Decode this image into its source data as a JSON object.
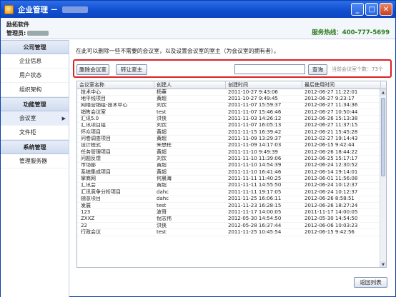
{
  "window": {
    "title": "企业管理 －",
    "min": "_",
    "max": "□",
    "close": "✕"
  },
  "header": {
    "company": "励拓软件",
    "admin_label": "管理员:",
    "hotline": "服务热线：400-777-5699"
  },
  "sidebar": {
    "sections": [
      {
        "title": "公司管理",
        "items": [
          "企业信息",
          "用户状态",
          "组织架构"
        ]
      },
      {
        "title": "功能管理",
        "items": [
          "会议室",
          "文件柜"
        ]
      },
      {
        "title": "系统管理",
        "items": [
          "管理服务器"
        ]
      }
    ],
    "active_item": "会议室"
  },
  "main": {
    "description": "在此可以删除一些不需要的会议室，以及设置会议室的室主（为会议室的拥有者）。",
    "buttons": {
      "delete": "删除会议室",
      "transfer": "转让室主",
      "search": "查询",
      "back": "返回列表"
    },
    "search_value": "",
    "count_label": "当前会议室个数：73个"
  },
  "table": {
    "columns": [
      "会议室名称",
      "创建人",
      "创建时间",
      "最后使用时间"
    ],
    "rows": [
      [
        "技术中心",
        "杨華",
        "2011-10-27 9:43:06",
        "2012-06-27 11:22:01"
      ],
      [
        "地平线项目",
        "黄超",
        "2011-10-27 9:49:45",
        "2012-06-27 9:23:17"
      ],
      [
        "网络营销组-技术中心",
        "刘饮",
        "2011-11-07 15:59:37",
        "2012-06-27 11:34:36"
      ],
      [
        "销售会议室",
        "test",
        "2011-11-07 15:46:46",
        "2012-06-27 10:50:44"
      ],
      [
        "汇讯5.0",
        "洪侠",
        "2011-11-03 14:26:12",
        "2012-06-26 15:13:38"
      ],
      [
        "汇讯项目组",
        "刘饮",
        "2011-11-07 16:05:13",
        "2012-06-27 11:37:15"
      ],
      [
        "怀众项目",
        "黄超",
        "2011-11-15 16:39:42",
        "2012-06-21 15:45:28"
      ],
      [
        "问卷调查项目",
        "黄超",
        "2011-11-09 13:29:37",
        "2012-02-27 19:14:43"
      ],
      [
        "设计模式",
        "朱懋柱",
        "2011-11-09 14:17:03",
        "2012-06-15 9:42:44"
      ],
      [
        "任务管理项目",
        "黄超",
        "2011-11-10 9:49:39",
        "2012-06-26 18:44:22"
      ],
      [
        "问题反馈",
        "刘饮",
        "2011-11-10 11:39:06",
        "2012-06-25 15:17:17"
      ],
      [
        "市场部",
        "黄超",
        "2011-11-10 14:54:39",
        "2012-06-24 12:30:52"
      ],
      [
        "系统集成项目",
        "黄超",
        "2011-11-10 16:41:46",
        "2012-06-14 19:14:01"
      ],
      [
        "掌商网",
        "何晨海",
        "2011-11-11 11:40:25",
        "2012-06-01 11:56:08"
      ],
      [
        "汇讯会",
        "黄超",
        "2011-11-11 14:55:50",
        "2012-06-24 10:12:37"
      ],
      [
        "汇讯竞争分析项目",
        "dahc",
        "2011-11-11 19:17:05",
        "2012-06-24 10:12:37"
      ],
      [
        "随意项目",
        "dahc",
        "2011-11-25 16:06:11",
        "2012-06-26 8:58:51"
      ],
      [
        "发展",
        "test",
        "2011-11-23 16:28:15",
        "2012-06-26 18:27:24"
      ],
      [
        "123",
        "波哥",
        "2011-11-17 14:00:05",
        "2011-11-17 14:00:05"
      ],
      [
        "ZXXZ",
        "倪志伟",
        "2012-05-30 14:54:50",
        "2012-05-30 14:54:50"
      ],
      [
        "22",
        "洪侠",
        "2012-05-28 16:37:44",
        "2012-06-06 10:03:23"
      ],
      [
        "行政会议",
        "test",
        "2011-11-25 10:45:54",
        "2012-06-15 9:42:56"
      ]
    ]
  },
  "colors": {
    "title_bar": "#1150d0",
    "highlight_border": "#e02020",
    "hotline": "#2a7d1e"
  }
}
